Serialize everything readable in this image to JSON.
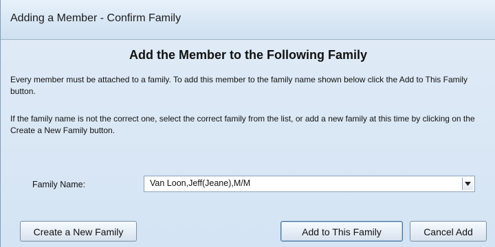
{
  "window": {
    "title": "Adding a Member - Confirm Family"
  },
  "content": {
    "heading": "Add the Member to the Following Family",
    "paragraph1": "Every member must be attached to a family. To add this member to the family name shown below click the Add to This Family button.",
    "paragraph2": "If the family name is not the correct one, select the correct family from the list, or add a new family at this time by clicking on the Create a New Family button."
  },
  "family": {
    "label": "Family Name:",
    "value": "Van Loon,Jeff(Jeane),M/M"
  },
  "buttons": {
    "create": "Create a New Family",
    "add": "Add to This Family",
    "cancel": "Cancel Add"
  }
}
